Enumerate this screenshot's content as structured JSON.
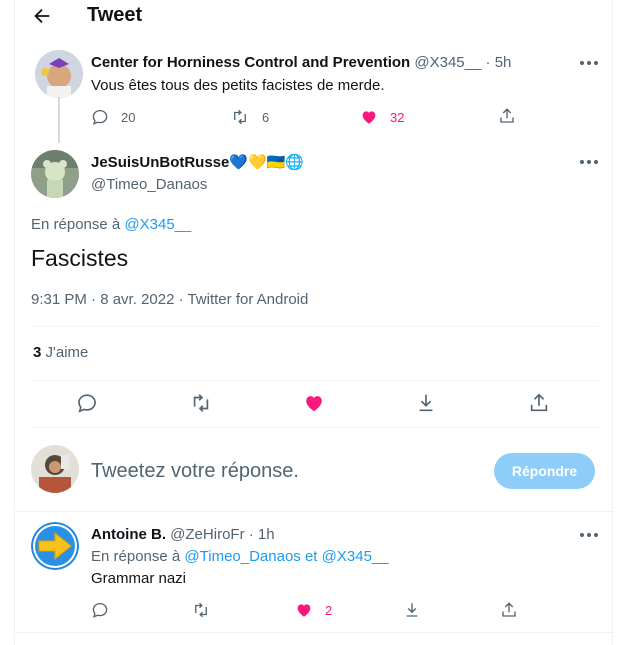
{
  "header": {
    "title": "Tweet"
  },
  "parent_tweet": {
    "author_name": "Center for Horniness Control and Prevention",
    "handle": "@X345__",
    "time": "5h",
    "text": "Vous êtes tous des petits facistes de merde.",
    "replies": "20",
    "retweets": "6",
    "likes": "32"
  },
  "main_tweet": {
    "author_name": "JeSuisUnBotRusse",
    "author_flags": "💙💛🇺🇦🌐",
    "handle": "@Timeo_Danaos",
    "reply_to_prefix": "En réponse à",
    "reply_to_handle": "@X345__",
    "text": "Fascistes",
    "timestamp": "9:31 PM · 8 avr. 2022 · Twitter for Android",
    "likes_count": "3",
    "likes_label": "J'aime"
  },
  "composer": {
    "placeholder": "Tweetez votre réponse.",
    "button_label": "Répondre"
  },
  "reply_tweet": {
    "author_name": "Antoine B.",
    "handle": "@ZeHiroFr",
    "time": "1h",
    "reply_to_prefix": "En réponse à",
    "reply_to_handle_1": "@Timeo_Danaos",
    "reply_to_joiner": "et",
    "reply_to_handle_2": "@X345__",
    "text": "Grammar nazi",
    "likes": "2"
  },
  "colors": {
    "accent": "#1d9bf0",
    "like": "#f91880",
    "muted": "#536471",
    "button_disabled": "#8ecdf8"
  },
  "icons": [
    "back-arrow-icon",
    "more-icon",
    "reply-icon",
    "retweet-icon",
    "heart-icon",
    "share-icon",
    "bookmark-icon",
    "arrow-right-icon"
  ]
}
